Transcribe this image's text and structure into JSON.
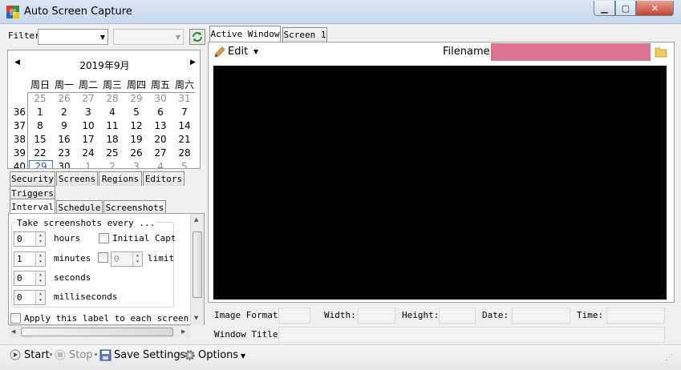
{
  "window": {
    "title": "Auto Screen Capture"
  },
  "filter": {
    "label": "Filter"
  },
  "calendar": {
    "title": "2019年9月",
    "weekdays": [
      "周日",
      "周一",
      "周二",
      "周三",
      "周四",
      "周五",
      "周六"
    ],
    "weeks": [
      {
        "num": "",
        "days": [
          "25",
          "26",
          "27",
          "28",
          "29",
          "30",
          "31"
        ]
      },
      {
        "num": "36",
        "days": [
          "1",
          "2",
          "3",
          "4",
          "5",
          "6",
          "7"
        ]
      },
      {
        "num": "37",
        "days": [
          "8",
          "9",
          "10",
          "11",
          "12",
          "13",
          "14"
        ]
      },
      {
        "num": "38",
        "days": [
          "15",
          "16",
          "17",
          "18",
          "19",
          "20",
          "21"
        ]
      },
      {
        "num": "39",
        "days": [
          "22",
          "23",
          "24",
          "25",
          "26",
          "27",
          "28"
        ]
      },
      {
        "num": "40",
        "days": [
          "29",
          "30",
          "1",
          "2",
          "3",
          "4",
          "5"
        ]
      }
    ]
  },
  "left_tabs": {
    "row1": [
      "Security",
      "Screens",
      "Regions",
      "Editors"
    ],
    "row2": [
      "Triggers"
    ],
    "row3": [
      "Interval",
      "Schedule",
      "Screenshots"
    ]
  },
  "interval": {
    "heading": "Take screenshots every ...",
    "hours_value": "0",
    "hours_label": "hours",
    "minutes_value": "1",
    "minutes_label": "minutes",
    "seconds_value": "0",
    "seconds_label": "seconds",
    "ms_value": "0",
    "ms_label": "milliseconds",
    "initial_capture": "Initial Captu",
    "limit_value": "0",
    "limit_label": "limit",
    "apply_label": "Apply this label to each screensho"
  },
  "right_tabs": [
    "Active Window",
    "Screen 1"
  ],
  "editor": {
    "edit_label": "Edit",
    "filename_label": "Filename:"
  },
  "info": {
    "image_format": "Image Format:",
    "width": "Width:",
    "height": "Height:",
    "date": "Date:",
    "time": "Time:",
    "window_title": "Window Title:"
  },
  "toolbar": {
    "start": "Start",
    "stop": "Stop",
    "save_settings": "Save Settings",
    "options": "Options"
  },
  "colors": {
    "filename_bg": "#dd7393",
    "preview_bg": "#000000"
  }
}
